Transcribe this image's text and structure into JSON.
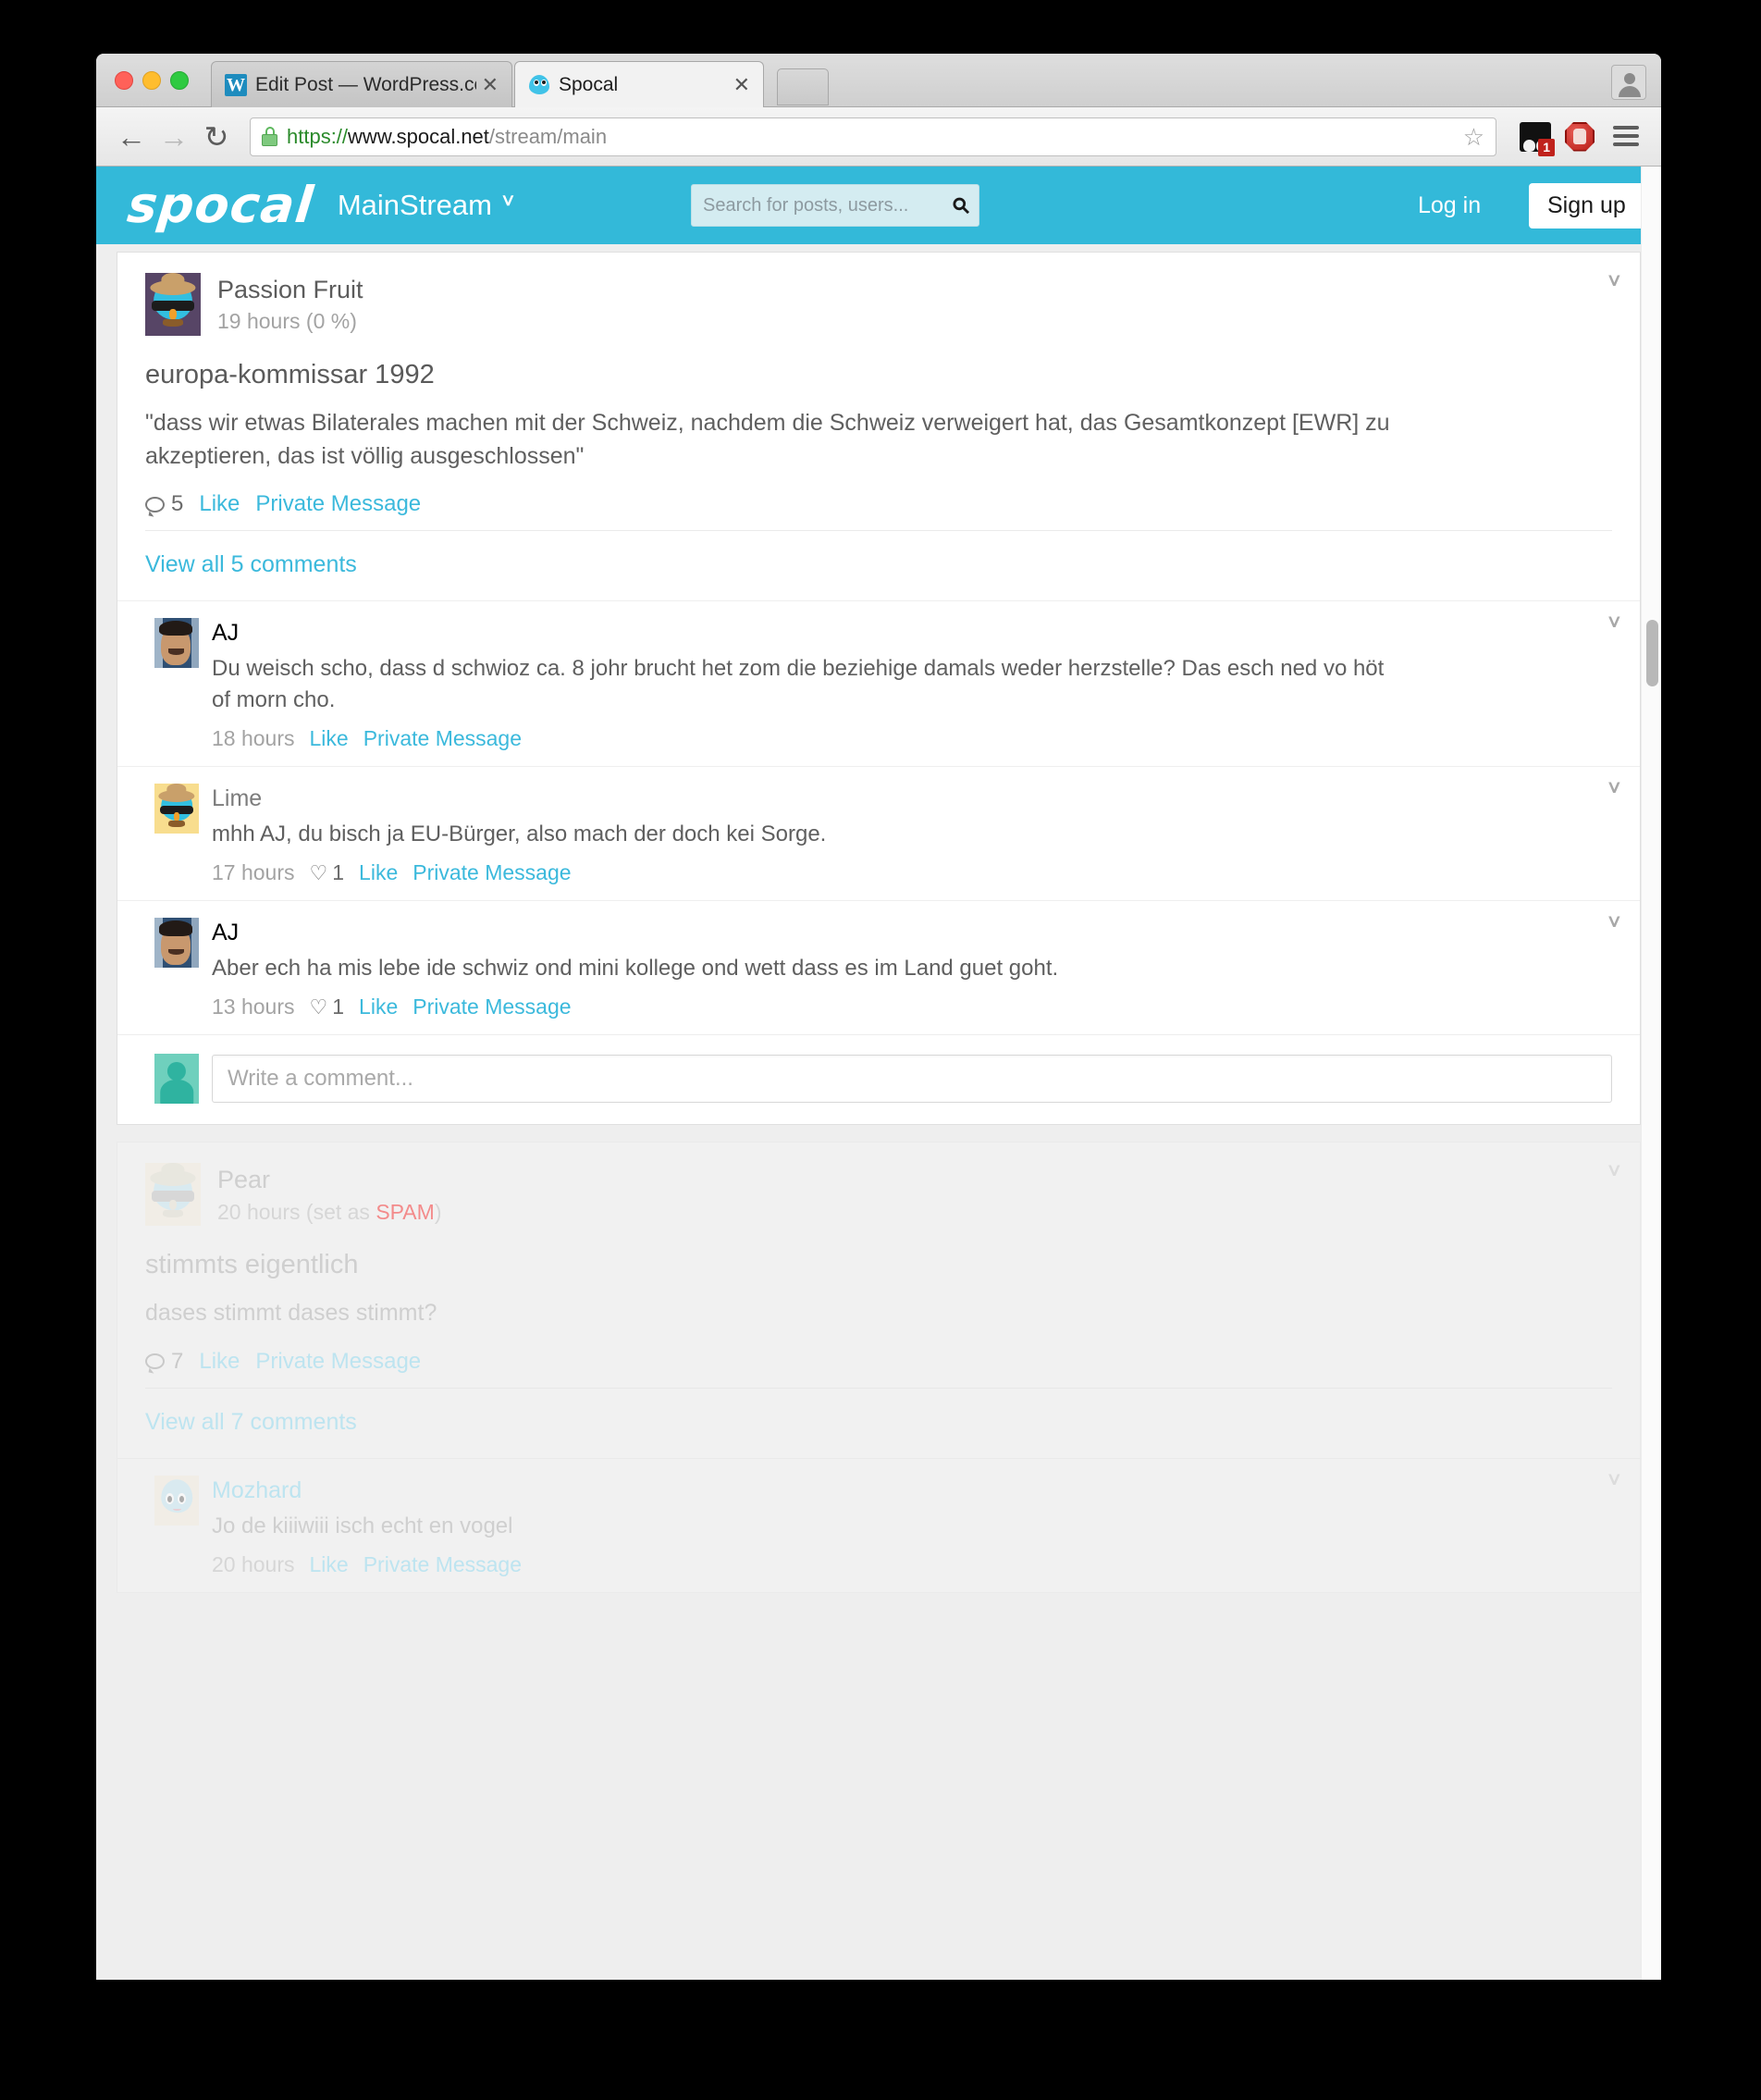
{
  "browser": {
    "tabs": [
      {
        "title": "Edit Post — WordPress.com",
        "favicon": "wordpress-icon",
        "active": false,
        "close_label": "✕"
      },
      {
        "title": "Spocal",
        "favicon": "spocal-ghost-icon",
        "active": true,
        "close_label": "✕"
      }
    ],
    "nav": {
      "back": "←",
      "forward": "→",
      "reload": "↻"
    },
    "url": {
      "scheme": "https://",
      "host": "www.spocal.net",
      "path": "/stream/main"
    },
    "bookmark_star": "☆",
    "extensions": [
      {
        "name": "facebook-notifier-icon",
        "badge": "1"
      },
      {
        "name": "adblock-icon",
        "badge": ""
      }
    ]
  },
  "site_header": {
    "logo_text": "spocal",
    "stream_label": "MainStream",
    "stream_chevron": "ⱽ",
    "search": {
      "placeholder": "Search for posts, users...",
      "value": "",
      "icon": "search-icon"
    },
    "login_label": "Log in",
    "signup_label": "Sign up",
    "accent_color": "#33b9d9"
  },
  "posts": [
    {
      "id": "post-passion-fruit",
      "spam": false,
      "author": "Passion Fruit",
      "time": "19 hours",
      "meta_suffix": "(0 %)",
      "title": "europa-kommissar 1992",
      "body": "\"dass wir etwas Bilaterales machen mit der Schweiz, nachdem die Schweiz verweigert hat, das Gesamtkonzept [EWR] zu akzeptieren, das ist völlig ausgeschlossen\"",
      "comment_count": "5",
      "like_label": "Like",
      "pm_label": "Private Message",
      "view_all_label": "View all 5 comments",
      "chevron": "ⱽ",
      "comments": [
        {
          "author": "AJ",
          "author_is_link": true,
          "avatar": "photo-avatar",
          "text": "Du weisch scho, dass d schwioz ca. 8 johr brucht het zom die beziehige damals weder herzstelle? Das esch ned vo höt of morn cho.",
          "time": "18 hours",
          "likes": "",
          "like_label": "Like",
          "pm_label": "Private Message"
        },
        {
          "author": "Lime",
          "author_is_link": false,
          "avatar": "yellow-face-avatar",
          "text": "mhh AJ, du bisch ja EU-Bürger, also mach der doch kei Sorge.",
          "time": "17 hours",
          "likes": "1",
          "like_label": "Like",
          "pm_label": "Private Message"
        },
        {
          "author": "AJ",
          "author_is_link": true,
          "avatar": "photo-avatar",
          "text": "Aber ech ha mis lebe ide schwiz ond mini kollege ond wett dass es im Land guet goht.",
          "time": "13 hours",
          "likes": "1",
          "like_label": "Like",
          "pm_label": "Private Message"
        }
      ],
      "compose": {
        "placeholder": "Write a comment...",
        "value": "",
        "avatar": "silhouette-avatar"
      }
    },
    {
      "id": "post-pear-spam",
      "spam": true,
      "author": "Pear",
      "time": "20 hours",
      "meta_prefix": "(set as ",
      "spam_tag": "SPAM",
      "meta_suffix": ")",
      "title": "stimmts eigentlich",
      "body": "dases stimmt dases stimmt?",
      "comment_count": "7",
      "like_label": "Like",
      "pm_label": "Private Message",
      "view_all_label": "View all 7 comments",
      "chevron": "ⱽ",
      "comments": [
        {
          "author": "Mozhard",
          "author_is_link": true,
          "avatar": "ghost-avatar",
          "text": "Jo de kiiiwiii isch echt en vogel",
          "time": "20 hours",
          "likes": "",
          "like_label": "Like",
          "pm_label": "Private Message"
        }
      ]
    }
  ]
}
